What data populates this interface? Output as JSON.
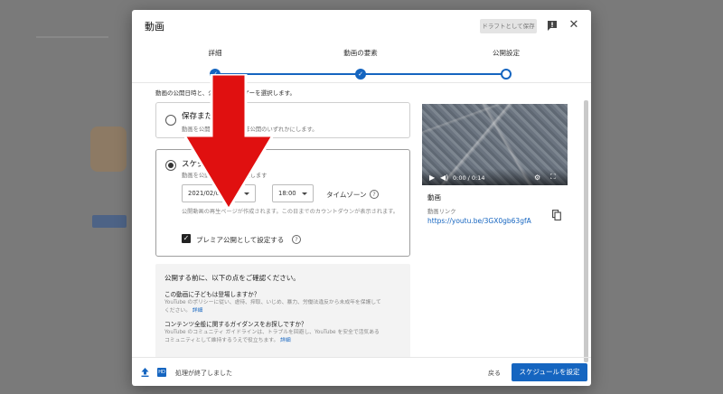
{
  "dialog": {
    "title": "動画",
    "draft_button": "ドラフトとして保存",
    "icons": {
      "feedback": "feedback-icon",
      "close": "close-icon"
    }
  },
  "stepper": {
    "steps": [
      {
        "label": "詳細",
        "state": "done"
      },
      {
        "label": "動画の要素",
        "state": "done"
      },
      {
        "label": "公開設定",
        "state": "current"
      }
    ]
  },
  "visibility": {
    "intro": "動画の公開日時と、公開するユーザーを選択します。",
    "save_option": {
      "title": "保存または公開",
      "desc": "動画を公開、限定公開、非公開のいずれかにします。",
      "selected": false
    },
    "schedule_option": {
      "title": "スケジュールを設定",
      "desc": "動画を公開する日時を選択します",
      "selected": true,
      "date": "2021/02/02",
      "time": "18:00",
      "timezone_label": "タイムゾーン",
      "premiere_note": "公開動画の再生ページが作成されます。この日までのカウントダウンが表示されます。",
      "premiere_label": "プレミア公開として設定する",
      "premiere_checked": true
    }
  },
  "info": {
    "title": "公開する前に、以下の点をご確認ください。",
    "q1": "この動画に子どもは登場しますか？",
    "a1": "YouTube のポリシーに従い、虐待、搾取、いじめ、暴力、労働法違反から未成年を保護してください。",
    "link1": "詳細",
    "q2": "コンテンツ全般に関するガイダンスをお探しですか？",
    "a2": "YouTube のコミュニティ ガイドラインは、トラブルを回避し、YouTube を安全で活気あるコミュニティとして維持するうえで役立ちます。",
    "link2": "詳細"
  },
  "preview": {
    "time": "0:00 / 0:14",
    "video_label": "動画",
    "link_label": "動画リンク",
    "url": "https://youtu.be/3GX0gb63gfA"
  },
  "footer": {
    "hd": "HD",
    "status": "処理が終了しました",
    "back": "戻る",
    "primary": "スケジュールを設定"
  },
  "colors": {
    "accent": "#1565c0",
    "arrow": "#e01010"
  }
}
